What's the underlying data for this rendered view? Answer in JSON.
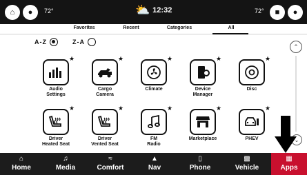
{
  "status_bar": {
    "left_temp": "72°",
    "right_temp": "72°",
    "time": "12:32",
    "weather_icon": "partly-sunny-icon"
  },
  "tabs": [
    {
      "label": "Favorites",
      "active": false
    },
    {
      "label": "Recent",
      "active": false
    },
    {
      "label": "Categories",
      "active": false
    },
    {
      "label": "All",
      "active": true
    }
  ],
  "sort": {
    "az_label": "A-Z",
    "za_label": "Z-A",
    "selected": "A-Z"
  },
  "apps": [
    {
      "label": "Audio\nSettings",
      "icon": "equalizer-icon"
    },
    {
      "label": "Cargo\nCamera",
      "icon": "cargo-camera-icon"
    },
    {
      "label": "Climate",
      "icon": "fan-icon"
    },
    {
      "label": "Device\nManager",
      "icon": "device-manager-icon"
    },
    {
      "label": "Disc",
      "icon": "disc-icon"
    },
    {
      "label": "Driver\nHeated Seat",
      "icon": "heated-seat-icon"
    },
    {
      "label": "Driver\nVented Seat",
      "icon": "vented-seat-icon"
    },
    {
      "label": "FM\nRadio",
      "icon": "music-note-icon"
    },
    {
      "label": "Marketplace",
      "icon": "storefront-icon"
    },
    {
      "label": "PHEV",
      "icon": "phev-icon"
    }
  ],
  "bottom_nav": [
    {
      "label": "Home",
      "icon": "home-icon",
      "active": false
    },
    {
      "label": "Media",
      "icon": "music-note-icon",
      "active": false
    },
    {
      "label": "Comfort",
      "icon": "comfort-icon",
      "active": false
    },
    {
      "label": "Nav",
      "icon": "navigation-arrow-icon",
      "active": false
    },
    {
      "label": "Phone",
      "icon": "phone-icon",
      "active": false
    },
    {
      "label": "Vehicle",
      "icon": "vehicle-icon",
      "active": false
    },
    {
      "label": "Apps",
      "icon": "apps-grid-icon",
      "active": true
    }
  ],
  "colors": {
    "accent": "#c8102e",
    "nav_bg": "#1c1c1c",
    "status_bg": "#141414"
  }
}
